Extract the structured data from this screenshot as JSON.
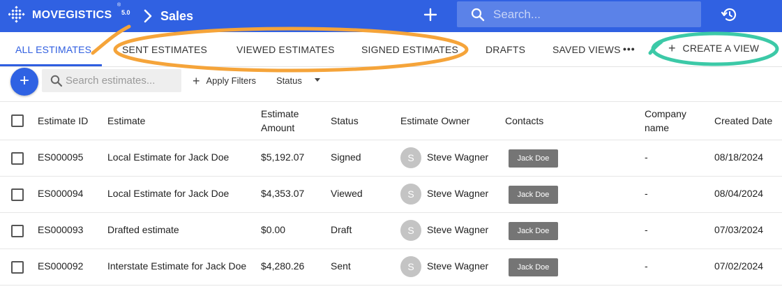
{
  "app": {
    "logo_text": "MOVEGISTICS",
    "logo_reg": "®",
    "version": "5.0",
    "section_title": "Sales"
  },
  "header": {
    "search_placeholder": "Search..."
  },
  "tabs": [
    {
      "label": "ALL ESTIMATES",
      "active": true
    },
    {
      "label": "SENT ESTIMATES",
      "active": false
    },
    {
      "label": "VIEWED ESTIMATES",
      "active": false
    },
    {
      "label": "SIGNED ESTIMATES",
      "active": false
    },
    {
      "label": "DRAFTS",
      "active": false
    },
    {
      "label": "SAVED VIEWS",
      "active": false
    }
  ],
  "tabs_more": "•••",
  "create_view": {
    "label": "CREATE A VIEW"
  },
  "toolbar": {
    "search_placeholder": "Search estimates...",
    "apply_filters": "Apply Filters",
    "status_filter": "Status"
  },
  "table": {
    "columns": {
      "id": "Estimate ID",
      "estimate": "Estimate",
      "amount_line1": "Estimate",
      "amount_line2": "Amount",
      "status": "Status",
      "owner": "Estimate Owner",
      "contacts": "Contacts",
      "company_line1": "Company",
      "company_line2": "name",
      "created": "Created Date"
    },
    "rows": [
      {
        "id": "ES000095",
        "estimate": "Local Estimate for Jack Doe",
        "amount": "$5,192.07",
        "status": "Signed",
        "owner_initial": "S",
        "owner": "Steve Wagner",
        "contact": "Jack Doe",
        "company": "-",
        "created": "08/18/2024"
      },
      {
        "id": "ES000094",
        "estimate": "Local Estimate for Jack Doe",
        "amount": "$4,353.07",
        "status": "Viewed",
        "owner_initial": "S",
        "owner": "Steve Wagner",
        "contact": "Jack Doe",
        "company": "-",
        "created": "08/04/2024"
      },
      {
        "id": "ES000093",
        "estimate": "Drafted estimate",
        "amount": "$0.00",
        "status": "Draft",
        "owner_initial": "S",
        "owner": "Steve Wagner",
        "contact": "Jack Doe",
        "company": "-",
        "created": "07/03/2024"
      },
      {
        "id": "ES000092",
        "estimate": "Interstate Estimate for Jack Doe",
        "amount": "$4,280.26",
        "status": "Sent",
        "owner_initial": "S",
        "owner": "Steve Wagner",
        "contact": "Jack Doe",
        "company": "-",
        "created": "07/02/2024"
      }
    ]
  },
  "colors": {
    "brand_blue": "#3061e2",
    "annotation_orange": "#f5a43a",
    "annotation_teal": "#3cc9a7"
  },
  "icons": {
    "logo": "movegistics-logo-icon",
    "breadcrumb": "chevron-right-icon",
    "add": "plus-icon",
    "search": "search-icon",
    "history": "history-icon",
    "more": "more-horizontal-icon",
    "dropdown": "caret-down-icon"
  }
}
